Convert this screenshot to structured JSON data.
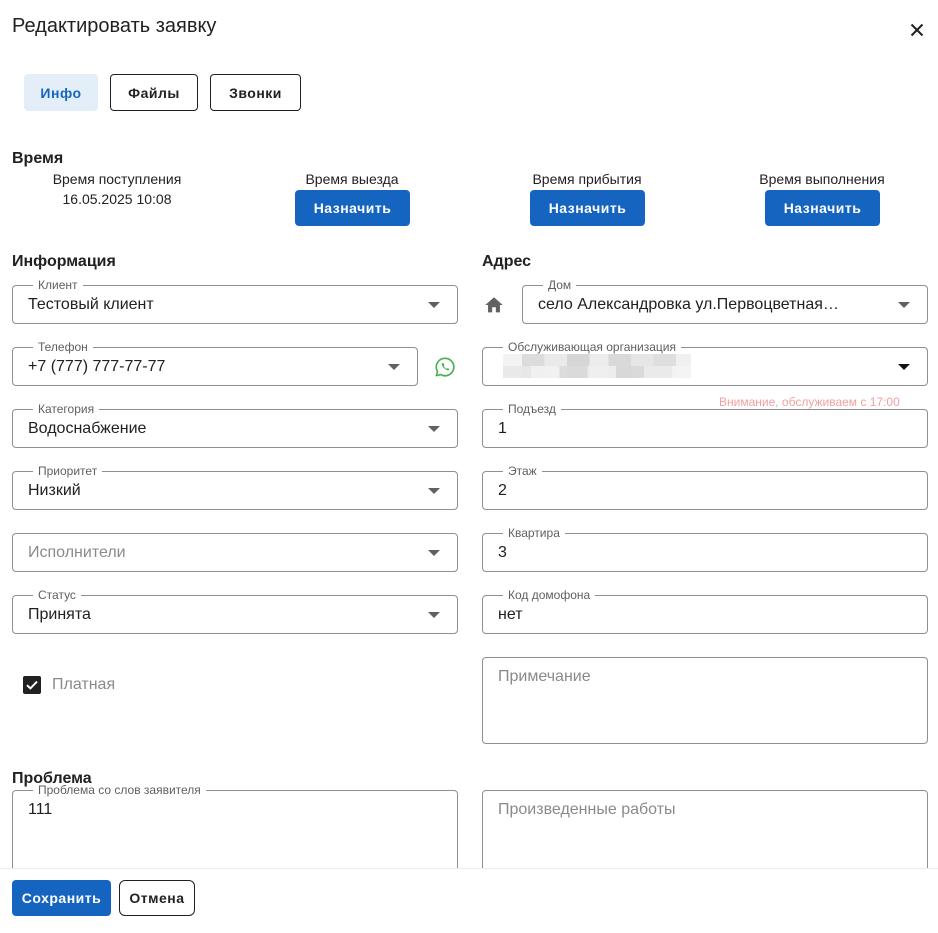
{
  "dialog": {
    "title": "Редактировать заявку"
  },
  "tabs": [
    {
      "label": "Инфо",
      "active": true
    },
    {
      "label": "Файлы",
      "active": false
    },
    {
      "label": "Звонки",
      "active": false
    }
  ],
  "time": {
    "title": "Время",
    "received_label": "Время поступления",
    "received_value": "16.05.2025 10:08",
    "departure_label": "Время выезда",
    "arrival_label": "Время прибытия",
    "completion_label": "Время выполнения",
    "assign_button": "Назначить"
  },
  "info": {
    "title": "Информация",
    "client": {
      "label": "Клиент",
      "value": "Тестовый клиент"
    },
    "phone": {
      "label": "Телефон",
      "value": "+7 (777) 777-77-77"
    },
    "category": {
      "label": "Категория",
      "value": "Водоснабжение"
    },
    "priority": {
      "label": "Приоритет",
      "value": "Низкий"
    },
    "executors": {
      "placeholder": "Исполнители"
    },
    "status": {
      "label": "Статус",
      "value": "Принята"
    },
    "paid": {
      "label": "Платная",
      "checked": true
    }
  },
  "address": {
    "title": "Адрес",
    "house": {
      "label": "Дом",
      "value": "село Александровка ул.Первоцветная…"
    },
    "org": {
      "label": "Обслуживающая организация",
      "value": ""
    },
    "warning": "Внимание, обслуживаем с 17:00",
    "entrance": {
      "label": "Подъезд",
      "value": "1"
    },
    "floor": {
      "label": "Этаж",
      "value": "2"
    },
    "apartment": {
      "label": "Квартира",
      "value": "3"
    },
    "intercom": {
      "label": "Код домофона",
      "value": "нет"
    },
    "note": {
      "placeholder": "Примечание"
    }
  },
  "problem": {
    "title": "Проблема",
    "description": {
      "label": "Проблема со слов заявителя",
      "value": "111"
    },
    "works": {
      "placeholder": "Произведенные работы"
    }
  },
  "footer": {
    "save": "Сохранить",
    "cancel": "Отмена"
  },
  "colors": {
    "primary": "#1565c0",
    "tab_active_bg": "#e3eef9",
    "whatsapp": "#4caf50",
    "warning": "#f2a0a0"
  }
}
